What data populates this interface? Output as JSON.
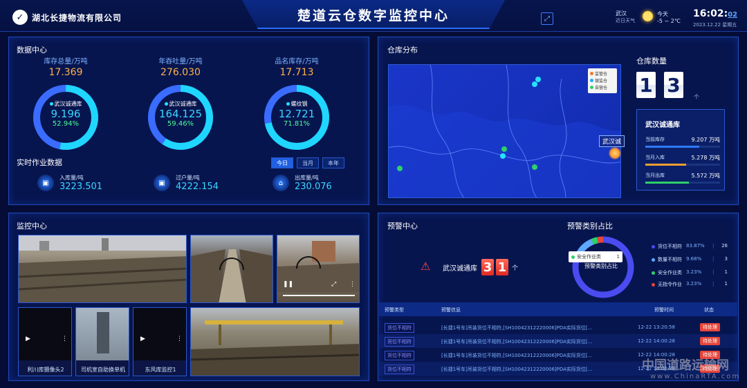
{
  "header": {
    "company": "湖北长捷物流有限公司",
    "title": "楚道云仓数字监控中心",
    "weather_city": "武汉",
    "weather_sub": "近日天气",
    "today_label": "今天",
    "today_temp": "-5 ~ 2℃",
    "time_hm": "16:02:",
    "time_sec": "02",
    "date": "2023.12.22 星期五"
  },
  "data_center": {
    "title": "数据中心",
    "donuts": [
      {
        "label": "库存总量/万吨",
        "total": "17.369",
        "center_name": "武汉诚通库",
        "center_value": "9.196",
        "center_pct": "52.94%",
        "share": 0.5294
      },
      {
        "label": "年吞吐量/万吨",
        "total": "276.030",
        "center_name": "武汉诚通库",
        "center_value": "164.125",
        "center_pct": "59.46%",
        "share": 0.5946
      },
      {
        "label": "品名库存/万吨",
        "total": "17.713",
        "center_name": "螺纹钢",
        "center_value": "12.721",
        "center_pct": "71.81%",
        "share": 0.7181
      }
    ],
    "realtime_title": "实时作业数据",
    "periods": [
      "今日",
      "当月",
      "本年"
    ],
    "stats": [
      {
        "label": "入库量/吨",
        "value": "3223.501"
      },
      {
        "label": "过户量/吨",
        "value": "4222.154"
      },
      {
        "label": "出库量/吨",
        "value": "230.076"
      }
    ]
  },
  "warehouse": {
    "title": "仓库分布",
    "legend": [
      "监管仓",
      "银监仓",
      "自营仓"
    ],
    "map_tag": "武汉诚",
    "count_label": "仓库数量",
    "count_digits": [
      "1",
      "3"
    ],
    "count_unit": "个",
    "card": {
      "name": "武汉诚通库",
      "rows": [
        {
          "key": "当前库存",
          "value": "9.207 万吨",
          "fill": 0.72,
          "color": "#2f7bff"
        },
        {
          "key": "当月入库",
          "value": "5.278 万吨",
          "fill": 0.55,
          "color": "#f0a030"
        },
        {
          "key": "当月出库",
          "value": "5.572 万吨",
          "fill": 0.58,
          "color": "#2fd06a"
        }
      ]
    }
  },
  "monitor": {
    "title": "监控中心",
    "captions": [
      "利川库摄像头2",
      "司机室自助换单机",
      "东风库监控1"
    ]
  },
  "alarm": {
    "title": "预警中心",
    "warehouse": "武汉诚通库",
    "digits": [
      "3",
      "1"
    ],
    "unit": "个",
    "chart_title": "预警类别占比",
    "donut_label": "预警类别占比",
    "tooltip_name": "安全作业类",
    "tooltip_value": "1",
    "categories": [
      {
        "name": "货位不相符",
        "pct": "83.87%",
        "count": "26",
        "color": "#4a4cf0"
      },
      {
        "name": "数量不相符",
        "pct": "9.68%",
        "count": "3",
        "color": "#5fa8ff"
      },
      {
        "name": "安全作业类",
        "pct": "3.23%",
        "count": "1",
        "color": "#2fd06a"
      },
      {
        "name": "无指令作业",
        "pct": "3.23%",
        "count": "1",
        "color": "#e8453a"
      }
    ],
    "table": {
      "headers": [
        "预警类型",
        "预警信息",
        "预警时间",
        "状态"
      ],
      "rows": [
        {
          "type": "货位不相符",
          "info": "[长捷1号车]吊装货位不相符,[SH10042312220006]PDA实际货位[...",
          "time": "12-22 13:20:58",
          "status": "待处理"
        },
        {
          "type": "货位不相符",
          "info": "[长捷1号车]吊装货位不相符,[SH10042312220006]PDA实际货位[...",
          "time": "12-22 14:00:28",
          "status": "待处理"
        },
        {
          "type": "货位不相符",
          "info": "[长捷1号车]吊装货位不相符,[SH10042312220006]PDA实际货位[...",
          "time": "12-22 14:00:28",
          "status": "待处理"
        },
        {
          "type": "货位不相符",
          "info": "[长捷1号车]吊装货位不相符,[SH10042312220006]PDA实际货位[...",
          "time": "12-22 14:00:28",
          "status": "待处理"
        }
      ]
    }
  },
  "watermark": {
    "main": "中国道路运输网",
    "sub": "www.ChinaRTA.com"
  },
  "colors": {
    "accent": "#3ad6ff",
    "orange": "#ffb347",
    "panel_border": "#1e4bbd",
    "alert": "#e8453a"
  }
}
